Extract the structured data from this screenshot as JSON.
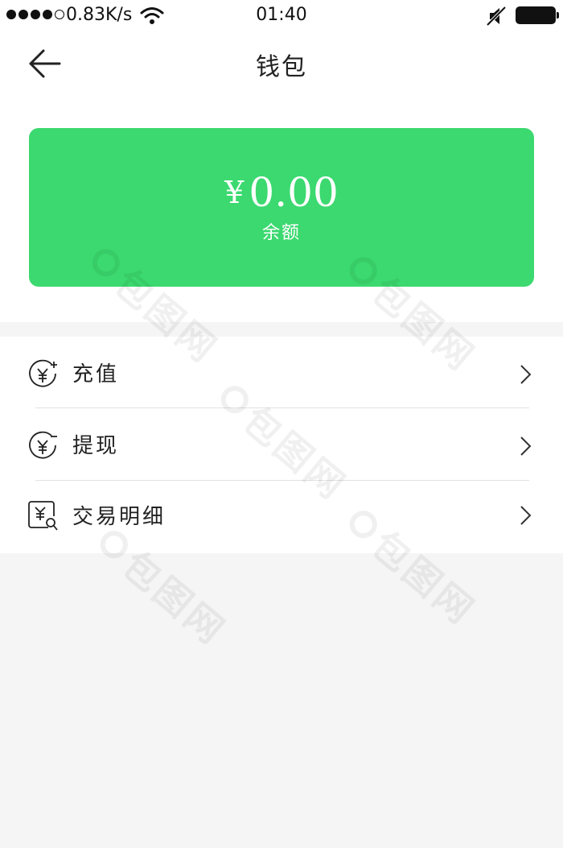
{
  "status_bar": {
    "net_speed": "0.83K/s",
    "time": "01:40"
  },
  "nav": {
    "title": "钱包"
  },
  "balance": {
    "currency_symbol": "¥",
    "amount": "0.00",
    "label": "余额"
  },
  "menu": {
    "items": [
      {
        "label": "充值",
        "icon": "yuan-plus-icon"
      },
      {
        "label": "提现",
        "icon": "yuan-minus-icon"
      },
      {
        "label": "交易明细",
        "icon": "transaction-search-icon"
      }
    ]
  },
  "watermark": {
    "text": "包图网"
  },
  "colors": {
    "accent": "#3bd96f",
    "page_background": "#f5f5f5",
    "card_text": "#ffffff"
  }
}
